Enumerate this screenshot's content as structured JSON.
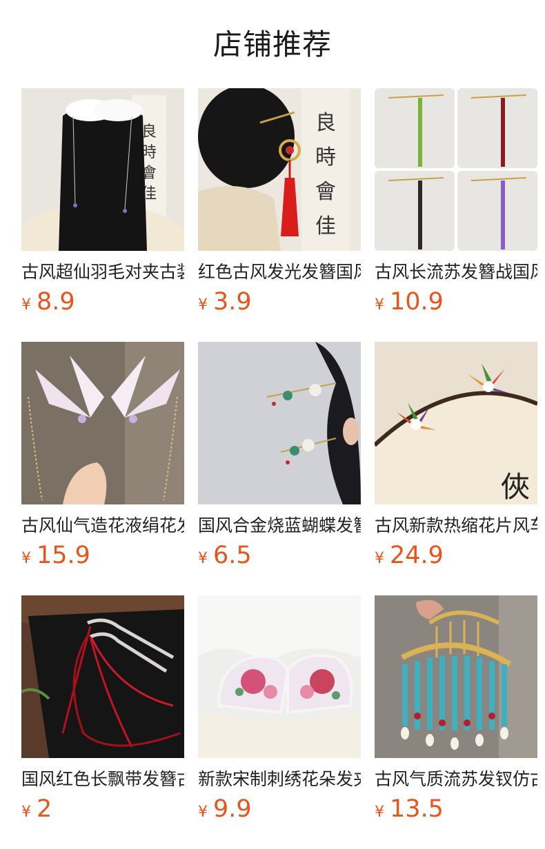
{
  "header": {
    "title": "店铺推荐"
  },
  "products": [
    {
      "name": "古风超仙羽毛对夹古装",
      "currency": "¥",
      "price": "8.9"
    },
    {
      "name": "红色古风发光发簪国风",
      "currency": "¥",
      "price": "3.9"
    },
    {
      "name": "古风长流苏发簪战国风",
      "currency": "¥",
      "price": "10.9"
    },
    {
      "name": "古风仙气造花液绢花发",
      "currency": "¥",
      "price": "15.9"
    },
    {
      "name": "国风合金烧蓝蝴蝶发簪",
      "currency": "¥",
      "price": "6.5"
    },
    {
      "name": "古风新款热缩花片风车",
      "currency": "¥",
      "price": "24.9"
    },
    {
      "name": "国风红色长飘带发簪古",
      "currency": "¥",
      "price": "2"
    },
    {
      "name": "新款宋制刺绣花朵发夹",
      "currency": "¥",
      "price": "9.9"
    },
    {
      "name": "古风气质流苏发钗仿古",
      "currency": "¥",
      "price": "13.5"
    }
  ],
  "colors": {
    "price": "#e8541c",
    "title": "#1a1a1a",
    "text": "#222222"
  },
  "icons": [
    "hair-product-photo-feather-clips",
    "hair-product-photo-red-tassel-hairpin",
    "hair-product-photo-long-tassel-hairpins",
    "hair-product-photo-silk-flower-wings",
    "hair-product-photo-butterfly-hairpin",
    "hair-product-photo-pinwheel-flowers",
    "hair-product-photo-red-ribbon-hairpins",
    "hair-product-photo-embroidered-clips",
    "hair-product-photo-turquoise-tassel-comb"
  ]
}
